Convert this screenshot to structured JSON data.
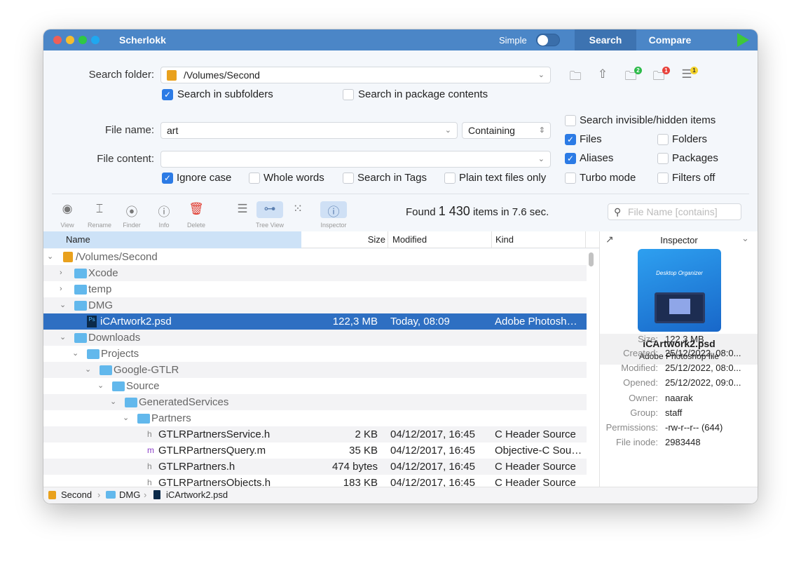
{
  "app": {
    "title": "Scherlokk",
    "simple_label": "Simple",
    "tabs": [
      "Search",
      "Compare"
    ]
  },
  "form": {
    "search_folder_label": "Search folder:",
    "search_folder_value": "/Volumes/Second",
    "search_subfolders": "Search in subfolders",
    "search_package": "Search in package contents",
    "file_name_label": "File name:",
    "file_name_value": "art",
    "match_mode": "Containing",
    "file_content_label": "File content:",
    "file_content_value": "",
    "ignore_case": "Ignore case",
    "whole_words": "Whole words",
    "search_tags": "Search in Tags",
    "plain_text": "Plain text files only",
    "invisible": "Search invisible/hidden items",
    "files": "Files",
    "folders": "Folders",
    "aliases": "Aliases",
    "packages": "Packages",
    "turbo": "Turbo mode",
    "filters_off": "Filters off",
    "badges": [
      "2",
      "1",
      "1"
    ]
  },
  "toolbar": {
    "view": "View",
    "rename": "Rename",
    "finder": "Finder",
    "info": "Info",
    "delete": "Delete",
    "tree_view": "Tree View",
    "inspector": "Inspector",
    "found_prefix": "Found",
    "found_count": "1 430",
    "found_suffix": "items in 7.6 sec.",
    "filter_placeholder": "File Name [contains]"
  },
  "columns": {
    "name": "Name",
    "size": "Size",
    "modified": "Modified",
    "kind": "Kind"
  },
  "rows": [
    {
      "name": "/Volumes/Second",
      "level": 0,
      "type": "disk",
      "open": true
    },
    {
      "name": "Xcode",
      "level": 1,
      "type": "folder",
      "open": false
    },
    {
      "name": "temp",
      "level": 1,
      "type": "folder",
      "open": false
    },
    {
      "name": "DMG",
      "level": 1,
      "type": "folder",
      "open": true
    },
    {
      "name": "iCArtwork2.psd",
      "level": 2,
      "type": "psd",
      "size": "122,3 MB",
      "modified": "Today, 08:09",
      "kind": "Adobe Photoshop file",
      "selected": true
    },
    {
      "name": "Downloads",
      "level": 1,
      "type": "folder",
      "open": true
    },
    {
      "name": "Projects",
      "level": 2,
      "type": "folder",
      "open": true
    },
    {
      "name": "Google-GTLR",
      "level": 3,
      "type": "folder",
      "open": true
    },
    {
      "name": "Source",
      "level": 4,
      "type": "folder",
      "open": true
    },
    {
      "name": "GeneratedServices",
      "level": 5,
      "type": "folder",
      "open": true
    },
    {
      "name": "Partners",
      "level": 6,
      "type": "folder",
      "open": true
    },
    {
      "name": "GTLRPartnersService.h",
      "level": 7,
      "type": "h",
      "size": "2 KB",
      "modified": "04/12/2017, 16:45",
      "kind": "C Header Source"
    },
    {
      "name": "GTLRPartnersQuery.m",
      "level": 7,
      "type": "m",
      "size": "35 KB",
      "modified": "04/12/2017, 16:45",
      "kind": "Objective-C Source"
    },
    {
      "name": "GTLRPartners.h",
      "level": 7,
      "type": "h",
      "size": "474 bytes",
      "modified": "04/12/2017, 16:45",
      "kind": "C Header Source"
    },
    {
      "name": "GTLRPartnersObjects.h",
      "level": 7,
      "type": "h",
      "size": "183 KB",
      "modified": "04/12/2017, 16:45",
      "kind": "C Header Source"
    }
  ],
  "inspector": {
    "title": "Inspector",
    "file_name": "iCArtwork2.psd",
    "file_kind": "Adobe Photoshop file",
    "preview_text": "Desktop Organizer",
    "fields": [
      [
        "Size:",
        "122,3 MB"
      ],
      [
        "Created:",
        "25/12/2022, 08:0..."
      ],
      [
        "Modified:",
        "25/12/2022, 08:0..."
      ],
      [
        "Opened:",
        "25/12/2022, 09:0..."
      ],
      [
        "Owner:",
        "naarak"
      ],
      [
        "Group:",
        "staff"
      ],
      [
        "Permissions:",
        "-rw-r--r-- (644)"
      ],
      [
        "File inode:",
        "2983448"
      ]
    ]
  },
  "breadcrumb": [
    "Second",
    "DMG",
    "iCArtwork2.psd"
  ]
}
